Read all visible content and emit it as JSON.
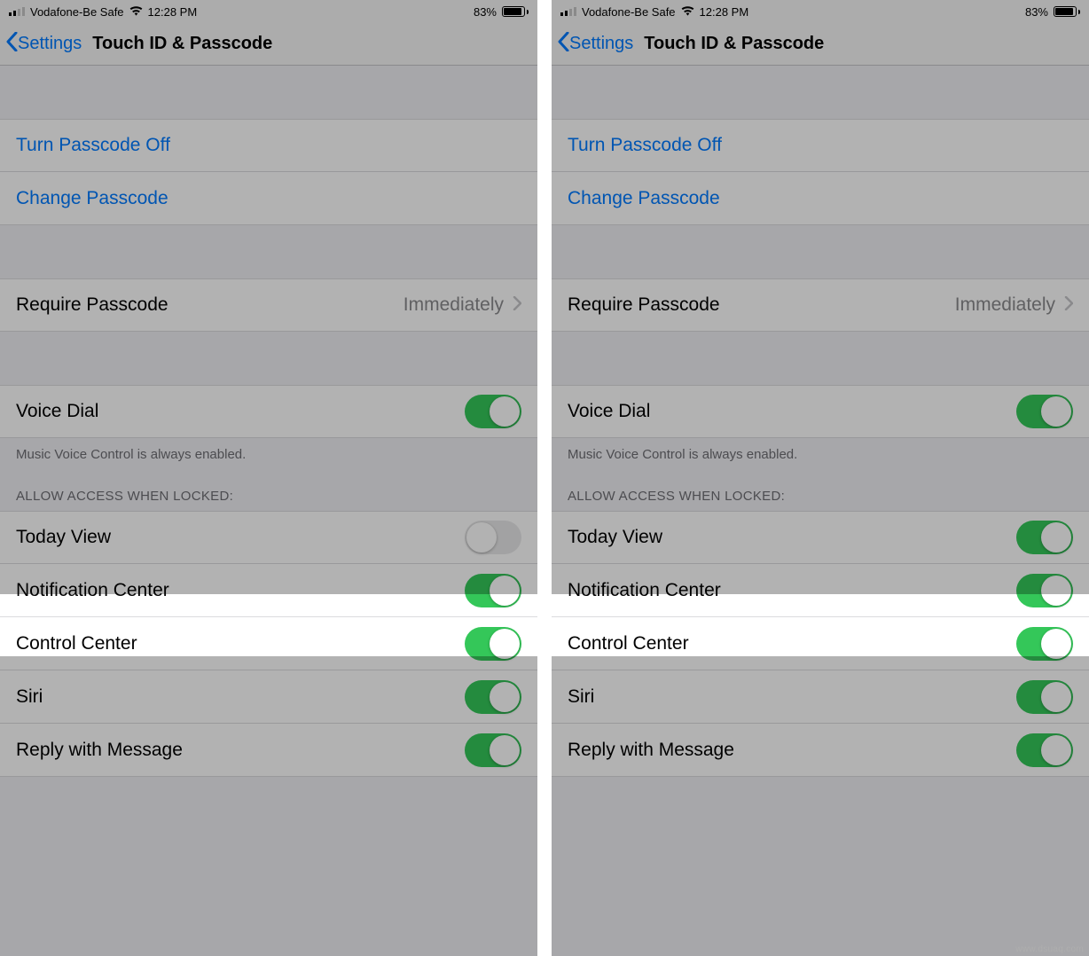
{
  "status": {
    "carrier": "Vodafone-Be Safe",
    "time": "12:28 PM",
    "battery": "83%"
  },
  "nav": {
    "back": "Settings",
    "title": "Touch ID & Passcode"
  },
  "links": {
    "turn_off": "Turn Passcode Off",
    "change": "Change Passcode"
  },
  "require": {
    "label": "Require Passcode",
    "value": "Immediately"
  },
  "voice_dial": {
    "label": "Voice Dial",
    "footer": "Music Voice Control is always enabled."
  },
  "section": "ALLOW ACCESS WHEN LOCKED:",
  "rows": {
    "today": "Today View",
    "nc": "Notification Center",
    "cc": "Control Center",
    "siri": "Siri",
    "reply": "Reply with Message"
  },
  "watermark": "www.dsuaq.com"
}
